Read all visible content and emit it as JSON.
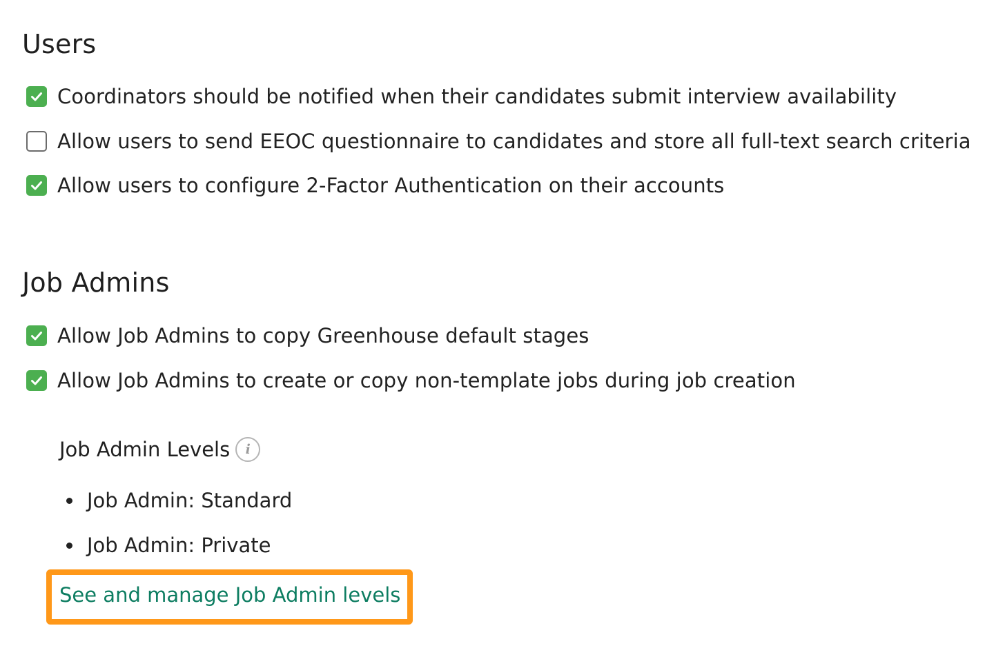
{
  "users": {
    "title": "Users",
    "options": [
      {
        "label": "Coordinators should be notified when their candidates submit interview availability",
        "checked": true
      },
      {
        "label": "Allow users to send EEOC questionnaire to candidates and store all full-text search criteria",
        "checked": false
      },
      {
        "label": "Allow users to configure 2-Factor Authentication on their accounts",
        "checked": true
      }
    ]
  },
  "job_admins": {
    "title": "Job Admins",
    "options": [
      {
        "label": "Allow Job Admins to copy Greenhouse default stages",
        "checked": true
      },
      {
        "label": "Allow Job Admins to create or copy non-template jobs during job creation",
        "checked": true
      }
    ],
    "levels": {
      "heading": "Job Admin Levels",
      "info_icon": "info-icon",
      "items": [
        "Job Admin: Standard",
        "Job Admin: Private"
      ],
      "manage_link": "See and manage Job Admin levels"
    }
  },
  "colors": {
    "checkbox_checked": "#4caf50",
    "link": "#0d7d61",
    "highlight": "#ff9819"
  }
}
